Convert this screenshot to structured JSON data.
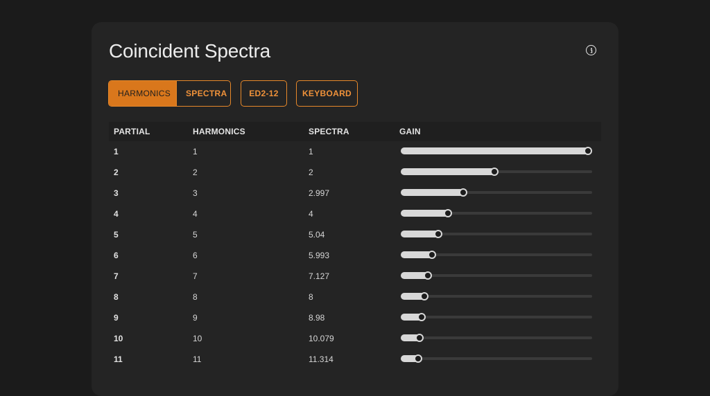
{
  "page": {
    "title": "Coincident Spectra",
    "info_icon": "info-circle-icon"
  },
  "modes": {
    "harmonics_label": "HARMONICS",
    "spectra_label": "SPECTRA",
    "active": "HARMONICS",
    "ed_label": "ED2-12",
    "keyboard_label": "KEYBOARD",
    "accent_color": "#d9771c"
  },
  "table": {
    "headers": [
      "PARTIAL",
      "HARMONICS",
      "SPECTRA",
      "GAIN"
    ],
    "rows": [
      {
        "partial": "1",
        "harmonics": "1",
        "spectra": "1",
        "gain": 1.0
      },
      {
        "partial": "2",
        "harmonics": "2",
        "spectra": "2",
        "gain": 0.5
      },
      {
        "partial": "3",
        "harmonics": "3",
        "spectra": "2.997",
        "gain": 0.333
      },
      {
        "partial": "4",
        "harmonics": "4",
        "spectra": "4",
        "gain": 0.25
      },
      {
        "partial": "5",
        "harmonics": "5",
        "spectra": "5.04",
        "gain": 0.2
      },
      {
        "partial": "6",
        "harmonics": "6",
        "spectra": "5.993",
        "gain": 0.167
      },
      {
        "partial": "7",
        "harmonics": "7",
        "spectra": "7.127",
        "gain": 0.143
      },
      {
        "partial": "8",
        "harmonics": "8",
        "spectra": "8",
        "gain": 0.125
      },
      {
        "partial": "9",
        "harmonics": "9",
        "spectra": "8.98",
        "gain": 0.111
      },
      {
        "partial": "10",
        "harmonics": "10",
        "spectra": "10.079",
        "gain": 0.1
      },
      {
        "partial": "11",
        "harmonics": "11",
        "spectra": "11.314",
        "gain": 0.091
      }
    ]
  }
}
